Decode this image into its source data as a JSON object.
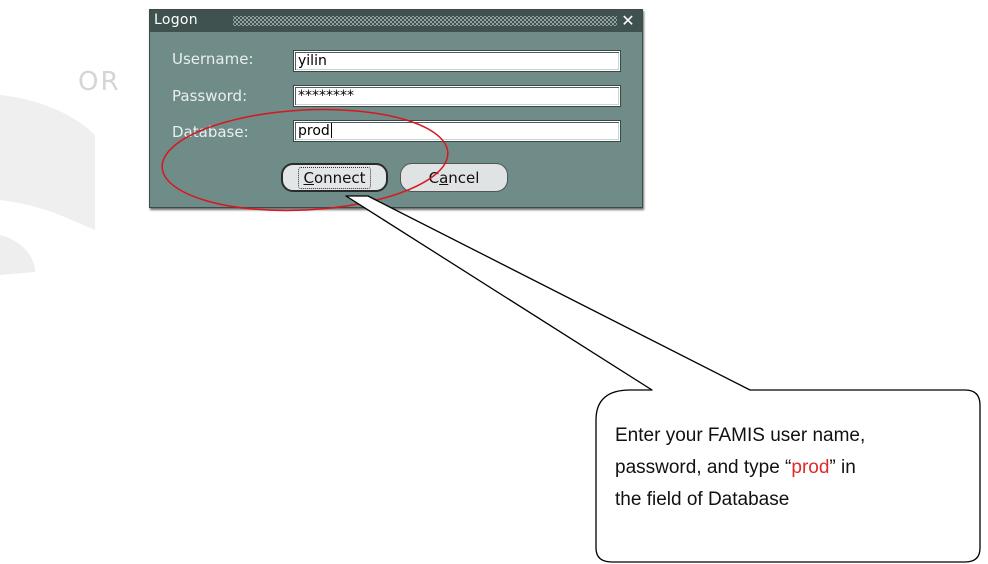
{
  "background": {
    "watermark_text": "OR"
  },
  "dialog": {
    "title": "Logon",
    "close_glyph": "✕",
    "fields": [
      {
        "label": "Username:",
        "value": "yilin"
      },
      {
        "label": "Password:",
        "value": "********"
      },
      {
        "label": "Database:",
        "value": "prod"
      }
    ],
    "buttons": {
      "connect_label": "Connect",
      "cancel_label": "Cancel"
    }
  },
  "callout": {
    "line1": "Enter your FAMIS user name,",
    "line2_pre": "password, and type “",
    "line2_highlight": "prod",
    "line2_post": "” in",
    "line3": "the field of Database",
    "highlight_color": "#e02a2a"
  },
  "colors": {
    "dialog_bg": "#6f8c88",
    "titlebar_bg": "#3f524f",
    "annotation_red": "#d8161d"
  }
}
